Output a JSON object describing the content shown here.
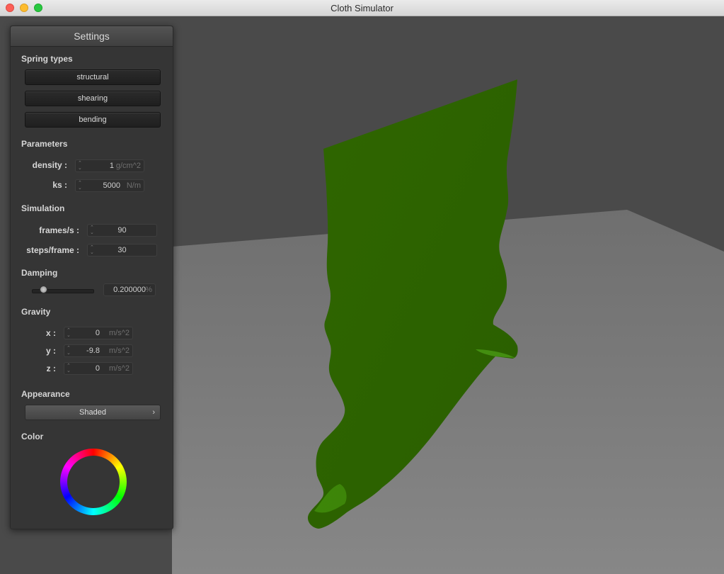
{
  "window": {
    "title": "Cloth Simulator"
  },
  "panel": {
    "title": "Settings",
    "spring_types": {
      "heading": "Spring types",
      "buttons": [
        "structural",
        "shearing",
        "bending"
      ]
    },
    "parameters": {
      "heading": "Parameters",
      "density": {
        "label": "density :",
        "value": "1",
        "unit": "g/cm^2"
      },
      "ks": {
        "label": "ks :",
        "value": "5000",
        "unit": "N/m"
      }
    },
    "simulation": {
      "heading": "Simulation",
      "frames": {
        "label": "frames/s :",
        "value": "90"
      },
      "steps": {
        "label": "steps/frame :",
        "value": "30"
      }
    },
    "damping": {
      "heading": "Damping",
      "value": "0.200000",
      "unit": "%",
      "slider_fraction": 0.2
    },
    "gravity": {
      "heading": "Gravity",
      "x": {
        "label": "x :",
        "value": "0",
        "unit": "m/s^2"
      },
      "y": {
        "label": "y :",
        "value": "-9.8",
        "unit": "m/s^2"
      },
      "z": {
        "label": "z :",
        "value": "0",
        "unit": "m/s^2"
      }
    },
    "appearance": {
      "heading": "Appearance",
      "mode": "Shaded"
    },
    "color": {
      "heading": "Color",
      "selected_hex": "#2f6b00"
    }
  },
  "scene": {
    "background_color": "#4a4a4a",
    "floor_color": "#7a7a7a",
    "cloth_color": "#2f6b00"
  }
}
